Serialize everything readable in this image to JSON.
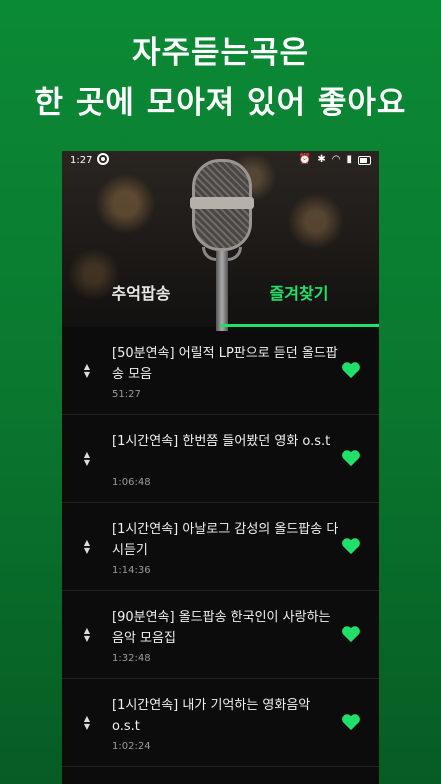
{
  "headline": {
    "line1": "자주듣는곡은",
    "line2": "한 곳에 모아져 있어 좋아요"
  },
  "status_bar": {
    "time": "1:27"
  },
  "tabs": [
    {
      "label": "추억팝송",
      "active": false
    },
    {
      "label": "즐겨찾기",
      "active": true
    }
  ],
  "colors": {
    "accent": "#21e06a",
    "background_green": "#0b8a35"
  },
  "favorites": [
    {
      "title": "[50분연속] 어릴적 LP판으로 듣던 올드팝송 모음",
      "duration": "51:27"
    },
    {
      "title": "[1시간연속] 한번쯤 들어봤던 영화 o.s.t",
      "duration": "1:06:48"
    },
    {
      "title": "[1시간연속] 아날로그 감성의 올드팝송 다시듣기",
      "duration": "1:14:36"
    },
    {
      "title": "[90분연속] 올드팝송 한국인이 사랑하는 음악 모음집",
      "duration": "1:32:48"
    },
    {
      "title": "[1시간연속] 내가 기억하는 영화음악 o.s.t",
      "duration": "1:02:24"
    }
  ]
}
